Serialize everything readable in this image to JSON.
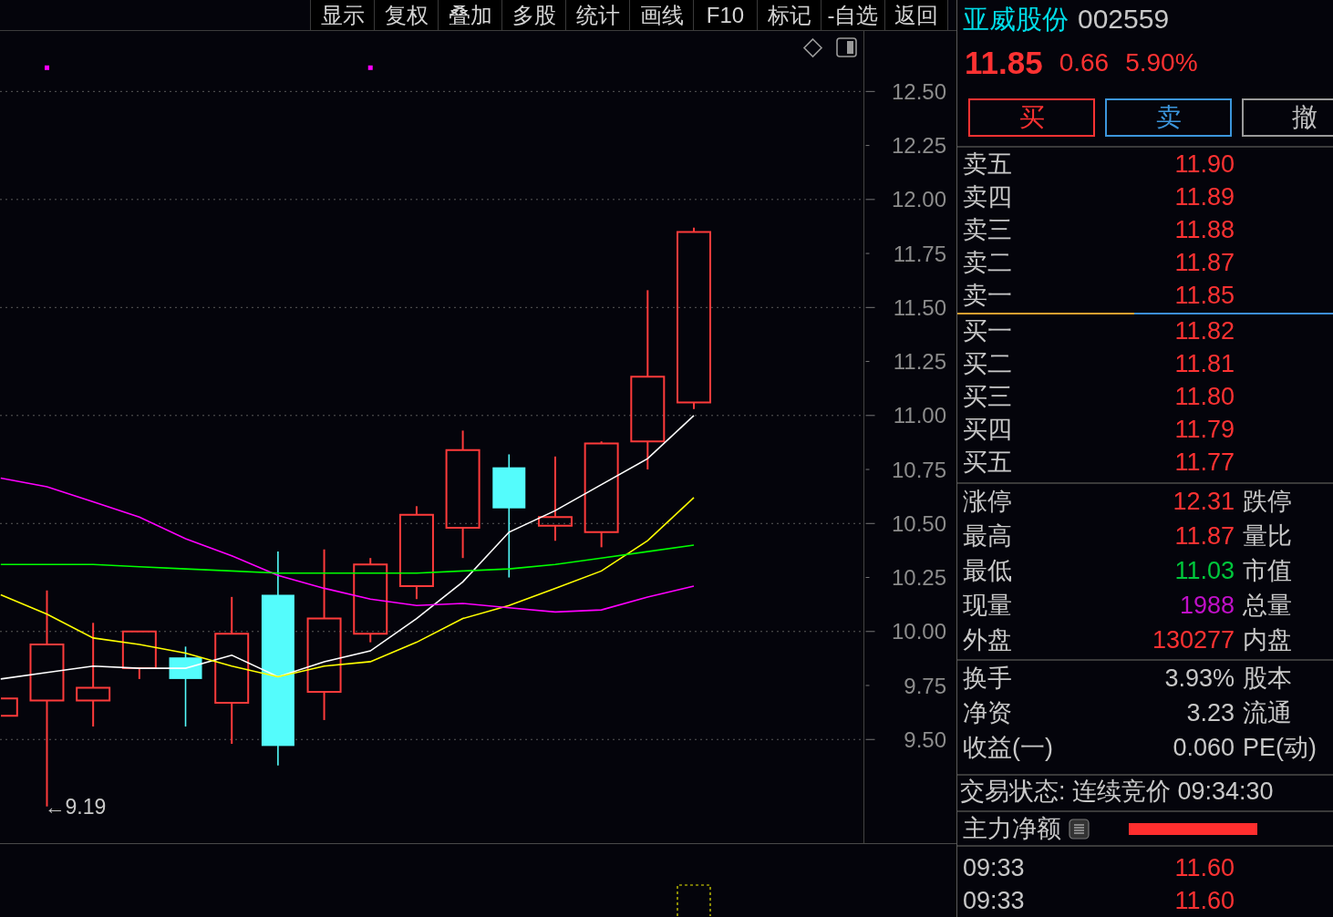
{
  "toolbar": [
    "显示",
    "复权",
    "叠加",
    "多股",
    "统计",
    "画线",
    "F10",
    "标记",
    "-自选",
    "返回"
  ],
  "chart": {
    "chart_data": [
      {
        "type": "candlestick",
        "categories": [
          null,
          null,
          null,
          null,
          null,
          null,
          null,
          null,
          null,
          null,
          null,
          null,
          null,
          null,
          null,
          null
        ],
        "ohlc": [
          [
            9.61,
            9.69,
            9.61,
            9.69
          ],
          [
            9.68,
            10.19,
            9.19,
            9.94
          ],
          [
            9.68,
            10.04,
            9.56,
            9.74
          ],
          [
            9.83,
            10.0,
            9.78,
            10.0
          ],
          [
            9.88,
            9.93,
            9.56,
            9.78
          ],
          [
            9.67,
            10.16,
            9.48,
            9.99
          ],
          [
            10.17,
            10.37,
            9.38,
            9.47
          ],
          [
            9.72,
            10.38,
            9.59,
            10.06
          ],
          [
            9.99,
            10.34,
            9.95,
            10.31
          ],
          [
            10.21,
            10.58,
            10.15,
            10.54
          ],
          [
            10.48,
            10.93,
            10.34,
            10.84
          ],
          [
            10.76,
            10.82,
            10.25,
            10.57
          ],
          [
            10.49,
            10.81,
            10.42,
            10.53
          ],
          [
            10.46,
            10.88,
            10.39,
            10.87
          ],
          [
            10.88,
            11.58,
            10.75,
            11.18
          ],
          [
            11.06,
            11.87,
            11.03,
            11.85
          ]
        ],
        "series": [
          {
            "type": "line",
            "color": "#ffffff",
            "values": [
              9.78,
              9.81,
              9.84,
              9.83,
              9.83,
              9.89,
              9.79,
              9.86,
              9.91,
              10.06,
              10.23,
              10.46,
              10.56,
              10.68,
              10.8,
              11.0
            ]
          },
          {
            "type": "line",
            "color": "#ffff00",
            "values": [
              10.17,
              10.08,
              9.97,
              9.94,
              9.9,
              9.84,
              9.79,
              9.84,
              9.86,
              9.95,
              10.06,
              10.12,
              10.2,
              10.28,
              10.42,
              10.62
            ]
          },
          {
            "type": "line",
            "color": "#ff00ff",
            "values": [
              10.71,
              10.67,
              10.6,
              10.53,
              10.43,
              10.35,
              10.26,
              10.2,
              10.15,
              10.12,
              10.13,
              10.11,
              10.09,
              10.1,
              10.16,
              10.21
            ]
          },
          {
            "type": "line",
            "color": "#00ff00",
            "values": [
              10.31,
              10.31,
              10.31,
              10.3,
              10.29,
              10.28,
              10.27,
              10.27,
              10.27,
              10.27,
              10.28,
              10.29,
              10.31,
              10.34,
              10.37,
              10.4
            ]
          },
          {
            "type": "scatter",
            "color": "#ff00ff",
            "marker": "square",
            "values": [
              null,
              12.61,
              null,
              null,
              null,
              null,
              null,
              null,
              12.61,
              null,
              null,
              null,
              null,
              null,
              null,
              null
            ]
          }
        ],
        "ylim": [
          9.02,
          12.78
        ],
        "yticks": [
          {
            "value": 9.5,
            "label": "9.50"
          },
          {
            "value": 9.75,
            "label": "9.75"
          },
          {
            "value": 10.0,
            "label": "10.00"
          },
          {
            "value": 10.25,
            "label": "10.25"
          },
          {
            "value": 10.5,
            "label": "10.50"
          },
          {
            "value": 10.75,
            "label": "10.75"
          },
          {
            "value": 11.0,
            "label": "11.00"
          },
          {
            "value": 11.25,
            "label": "11.25"
          },
          {
            "value": 11.5,
            "label": "11.50"
          },
          {
            "value": 11.75,
            "label": "11.75"
          },
          {
            "value": 12.0,
            "label": "12.00"
          },
          {
            "value": 12.25,
            "label": "12.25"
          },
          {
            "value": 12.5,
            "label": "12.50"
          }
        ],
        "grid": true,
        "annotations": [
          "←9.19"
        ]
      }
    ]
  },
  "quote": {
    "name": "亚威股份",
    "code": "002559",
    "price": "11.85",
    "change": "0.66",
    "change_percent": "5.90%"
  },
  "trade_buttons": [
    {
      "label": "买",
      "kind": "buy"
    },
    {
      "label": "卖",
      "kind": "sell"
    },
    {
      "label": "撤",
      "kind": "cancel"
    }
  ],
  "asks": [
    {
      "label": "卖五",
      "price": "11.90"
    },
    {
      "label": "卖四",
      "price": "11.89"
    },
    {
      "label": "卖三",
      "price": "11.88"
    },
    {
      "label": "卖二",
      "price": "11.87"
    },
    {
      "label": "卖一",
      "price": "11.85"
    }
  ],
  "order_ratio": {
    "level": 0.47
  },
  "bids": [
    {
      "label": "买一",
      "price": "11.82"
    },
    {
      "label": "买二",
      "price": "11.81"
    },
    {
      "label": "买三",
      "price": "11.80"
    },
    {
      "label": "买四",
      "price": "11.79"
    },
    {
      "label": "买五",
      "price": "11.77"
    }
  ],
  "quote_stats": [
    {
      "label": "涨停",
      "value": "12.31",
      "color": "#ff3232",
      "label_2": "跌停"
    },
    {
      "label": "最高",
      "value": "11.87",
      "color": "#ff3232",
      "label_2": "量比"
    },
    {
      "label": "最低",
      "value": "11.03",
      "color": "#00c83c",
      "label_2": "市值"
    },
    {
      "label": "现量",
      "value": "1988",
      "color": "#c010c8",
      "label_2": "总量"
    },
    {
      "label": "外盘",
      "value": "130277",
      "color": "#ff3232",
      "label_2": "内盘"
    }
  ],
  "fundamentals": [
    {
      "label": "换手",
      "value": "3.93%",
      "label_2": "股本"
    },
    {
      "label": "净资",
      "value": "3.23",
      "label_2": "流通"
    },
    {
      "label": "收益(一)",
      "value": "0.060",
      "label_2": "PE(动)"
    }
  ],
  "trading_status": "交易状态: 连续竞价 09:34:30",
  "main_net": {
    "label": "主力净额",
    "level": 0.63
  },
  "ticks": [
    {
      "time": "09:33",
      "price": "11.60"
    },
    {
      "time": "09:33",
      "price": "11.60"
    }
  ]
}
